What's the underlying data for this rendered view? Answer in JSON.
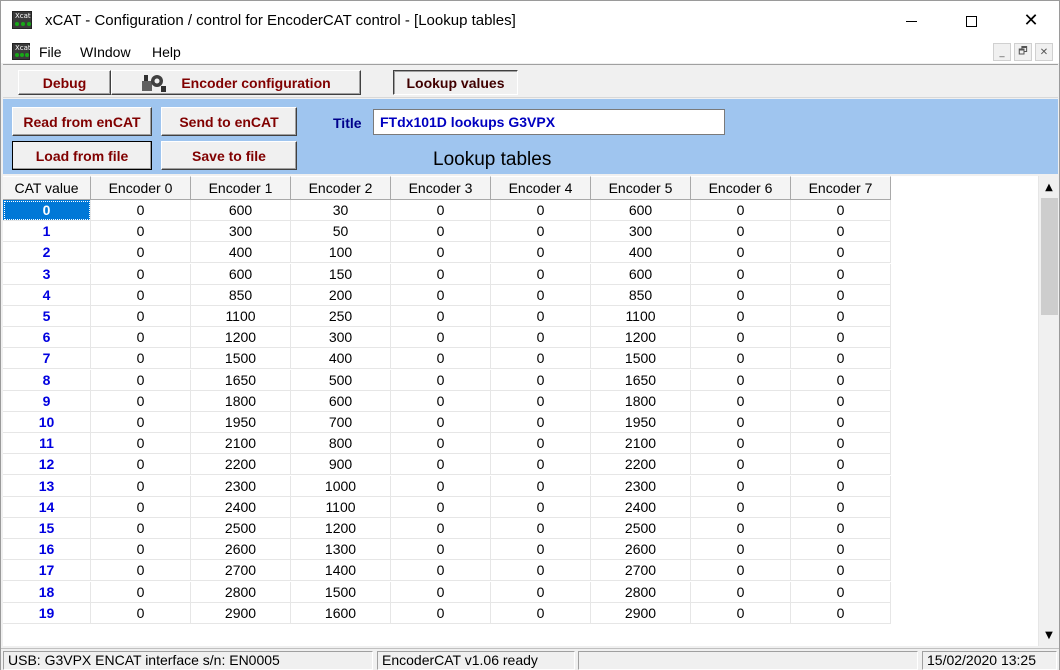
{
  "window": {
    "title": "xCAT -  Configuration / control for  EncoderCAT control - [Lookup tables]",
    "icon": "xcat-app-icon",
    "app_icon_text": "Xcat",
    "controls": {
      "minimize": "minimize-icon",
      "maximize": "maximize-icon",
      "close": "close-icon"
    }
  },
  "menu": {
    "items": [
      "File",
      "WIndow",
      "Help"
    ],
    "mdi_controls": [
      "_",
      "🗗",
      "✕"
    ]
  },
  "toolbar": {
    "debug_label": "Debug",
    "encoder_config_label": "Encoder configuration",
    "lookup_values_label": "Lookup values"
  },
  "panel": {
    "read_label": "Read from enCAT",
    "send_label": "Send to enCAT",
    "load_label": "Load from file",
    "save_label": "Save to file",
    "title_label": "Title",
    "title_value": "FTdx101D lookups G3VPX",
    "heading": "Lookup tables"
  },
  "table": {
    "columns": [
      "CAT value",
      "Encoder 0",
      "Encoder 1",
      "Encoder 2",
      "Encoder 3",
      "Encoder 4",
      "Encoder 5",
      "Encoder 6",
      "Encoder 7"
    ],
    "rows": [
      [
        "0",
        "0",
        "600",
        "30",
        "0",
        "0",
        "600",
        "0",
        "0"
      ],
      [
        "1",
        "0",
        "300",
        "50",
        "0",
        "0",
        "300",
        "0",
        "0"
      ],
      [
        "2",
        "0",
        "400",
        "100",
        "0",
        "0",
        "400",
        "0",
        "0"
      ],
      [
        "3",
        "0",
        "600",
        "150",
        "0",
        "0",
        "600",
        "0",
        "0"
      ],
      [
        "4",
        "0",
        "850",
        "200",
        "0",
        "0",
        "850",
        "0",
        "0"
      ],
      [
        "5",
        "0",
        "1100",
        "250",
        "0",
        "0",
        "1100",
        "0",
        "0"
      ],
      [
        "6",
        "0",
        "1200",
        "300",
        "0",
        "0",
        "1200",
        "0",
        "0"
      ],
      [
        "7",
        "0",
        "1500",
        "400",
        "0",
        "0",
        "1500",
        "0",
        "0"
      ],
      [
        "8",
        "0",
        "1650",
        "500",
        "0",
        "0",
        "1650",
        "0",
        "0"
      ],
      [
        "9",
        "0",
        "1800",
        "600",
        "0",
        "0",
        "1800",
        "0",
        "0"
      ],
      [
        "10",
        "0",
        "1950",
        "700",
        "0",
        "0",
        "1950",
        "0",
        "0"
      ],
      [
        "11",
        "0",
        "2100",
        "800",
        "0",
        "0",
        "2100",
        "0",
        "0"
      ],
      [
        "12",
        "0",
        "2200",
        "900",
        "0",
        "0",
        "2200",
        "0",
        "0"
      ],
      [
        "13",
        "0",
        "2300",
        "1000",
        "0",
        "0",
        "2300",
        "0",
        "0"
      ],
      [
        "14",
        "0",
        "2400",
        "1100",
        "0",
        "0",
        "2400",
        "0",
        "0"
      ],
      [
        "15",
        "0",
        "2500",
        "1200",
        "0",
        "0",
        "2500",
        "0",
        "0"
      ],
      [
        "16",
        "0",
        "2600",
        "1300",
        "0",
        "0",
        "2600",
        "0",
        "0"
      ],
      [
        "17",
        "0",
        "2700",
        "1400",
        "0",
        "0",
        "2700",
        "0",
        "0"
      ],
      [
        "18",
        "0",
        "2800",
        "1500",
        "0",
        "0",
        "2800",
        "0",
        "0"
      ],
      [
        "19",
        "0",
        "2900",
        "1600",
        "0",
        "0",
        "2900",
        "0",
        "0"
      ]
    ],
    "selected_row": 0
  },
  "status": {
    "interface": "USB: G3VPX ENCAT interface  s/n: EN0005",
    "version": "EncoderCAT v1.06 ready",
    "empty": "",
    "datetime": "15/02/2020 13:25"
  },
  "colors": {
    "panel_bg": "#9fc5ef",
    "button_text": "#800000",
    "cat_value_text": "#0000e0",
    "title_value_text": "#0000c0",
    "selection": "#0078d7"
  }
}
